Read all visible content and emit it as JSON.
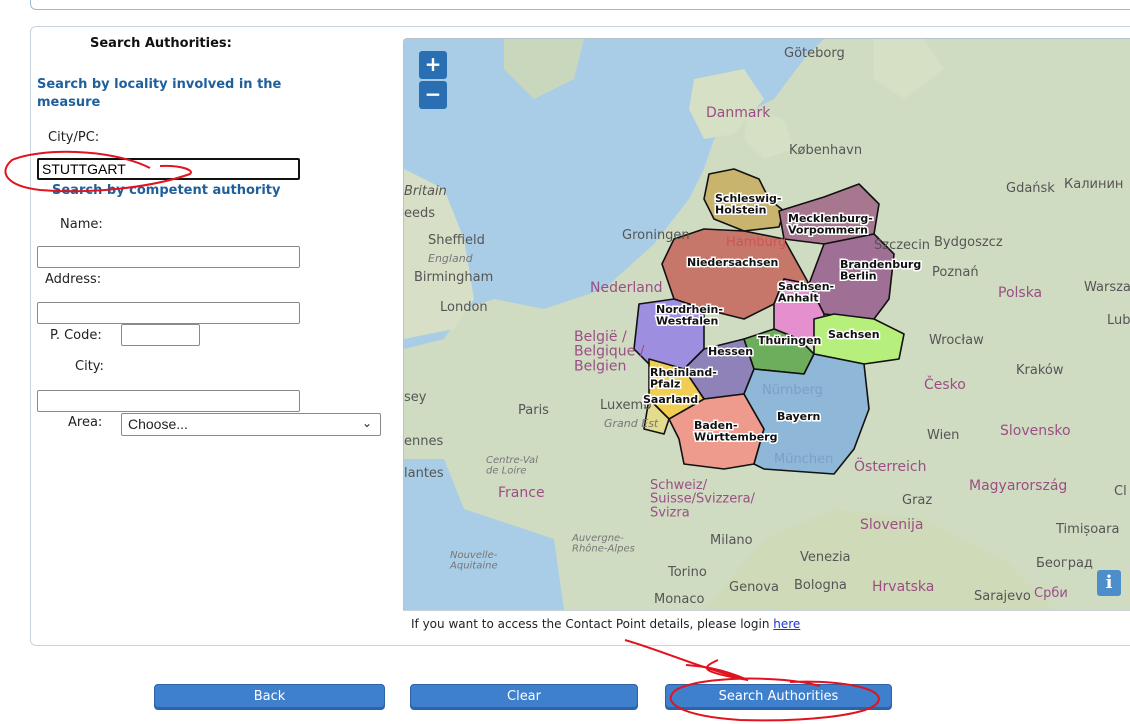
{
  "form": {
    "title": "Search Authorities:",
    "section_locality": "Search by locality involved in the measure",
    "city_pc_label": "City/PC:",
    "city_pc_value": "STUTTGART",
    "section_authority": "Search by competent authority",
    "name_label": "Name:",
    "address_label": "Address:",
    "pcode_label": "P. Code:",
    "city_label": "City:",
    "area_label": "Area:",
    "area_selected": "Choose..."
  },
  "map": {
    "zoom_in": "+",
    "zoom_out": "−",
    "info": "i",
    "footer_text": "If you want to access the Contact Point details, please login ",
    "footer_link": "here",
    "places": {
      "goteborg": "Göteborg",
      "danmark": "Danmark",
      "kobenhavn": "København",
      "gdansk": "Gdańsk",
      "kaliningrad": "Калинин",
      "britain": "Britain",
      "leeds": "eeds",
      "sheffield": "Sheffield",
      "england": "England",
      "birmingham": "Birmingham",
      "london": "London",
      "nederland": "Nederland",
      "groningen": "Groningen",
      "hamburg": "Hamburg",
      "szczecin": "Szczecin",
      "bydgoszcz": "Bydgoszcz",
      "poznan": "Poznań",
      "polska": "Polska",
      "warszawa": "Warsza",
      "lublin": "Lubl",
      "belgie": "België /\nBelgique /\nBelgien",
      "wroclaw": "Wrocław",
      "krakow": "Kraków",
      "cesko": "Česko",
      "paris": "Paris",
      "luxembourg": "Luxemb",
      "grand_est": "Grand Est",
      "nurnberg": "Nürnberg",
      "munchen": "München",
      "wien": "Wien",
      "slovensko": "Slovensko",
      "rennes": "ennes",
      "nantes": "lantes",
      "centre": "Centre-Val\nde Loire",
      "france": "France",
      "schweiz": "Schweiz/\nSuisse/Svizzera/\nSvizra",
      "osterreich": "Österreich",
      "magyarorszag": "Magyarország",
      "graz": "Graz",
      "slovenija": "Slovenija",
      "timisoara": "Timișoara",
      "auvergne": "Auvergne-\nRhône-Alpes",
      "milano": "Milano",
      "nouvelle": "Nouvelle-\nAquitaine",
      "torino": "Torino",
      "venezia": "Venezia",
      "beograd": "Београд",
      "genova": "Genova",
      "bologna": "Bologna",
      "hrvatska": "Hrvatska",
      "monaco": "Monaco",
      "sarajevo": "Sarajevo",
      "srbija": "Срби",
      "sey": "sey",
      "cl": "Cl"
    },
    "states": {
      "sh": "Schleswig-\nHolstein",
      "mv": "Mecklenburg-\nVorpommern",
      "ni": "Niedersachsen",
      "bb": "Brandenburg\nBerlin",
      "st": "Sachsen-\nAnhalt",
      "nw": "Nordrhein-\nWestfalen",
      "th": "Thüringen",
      "sn": "Sachsen",
      "he": "Hessen",
      "rp": "Rheinland-\nPfalz",
      "sl": "Saarland",
      "bw": "Baden-\nWürttemberg",
      "by": "Bayern"
    }
  },
  "buttons": {
    "back": "Back",
    "clear": "Clear",
    "search": "Search Authorities"
  },
  "colors": {
    "accent": "#3f80cc",
    "section_title": "#1f5f9c",
    "annotation": "#e0141e"
  }
}
